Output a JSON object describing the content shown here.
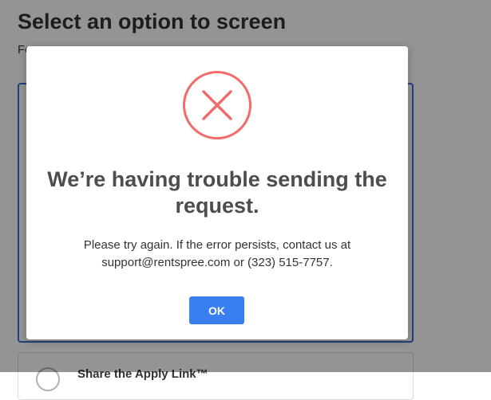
{
  "page": {
    "title": "Select an option to screen",
    "subtitle": "Fo",
    "option_two_label": "Share the Apply Link™"
  },
  "modal": {
    "icon": "error-x-circle-icon",
    "heading": "We’re having trouble sending the request.",
    "message_line1": "Please try again. If the error persists, contact us at",
    "message_line2": "support@rentspree.com or (323) 515-7757.",
    "ok_label": "OK"
  },
  "colors": {
    "error_red": "#f26a6a",
    "button_blue": "#3a7fef",
    "selected_border": "#3b6fd6"
  }
}
